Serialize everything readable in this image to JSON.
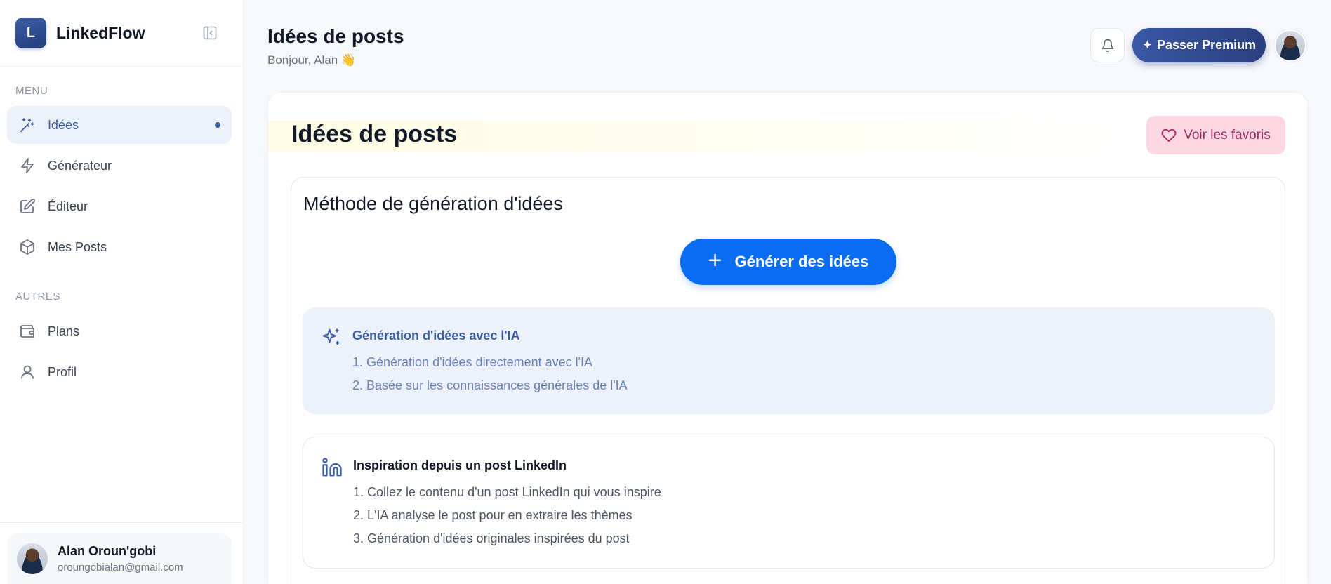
{
  "app": {
    "logo_letter": "L",
    "name": "LinkedFlow"
  },
  "sidebar": {
    "menu_label": "MENU",
    "items": [
      {
        "label": "Idées",
        "icon": "magic-wand-icon",
        "active": true
      },
      {
        "label": "Générateur",
        "icon": "lightning-icon"
      },
      {
        "label": "Éditeur",
        "icon": "edit-icon"
      },
      {
        "label": "Mes Posts",
        "icon": "box-icon"
      }
    ],
    "other_label": "AUTRES",
    "other_items": [
      {
        "label": "Plans",
        "icon": "wallet-icon"
      },
      {
        "label": "Profil",
        "icon": "user-icon"
      }
    ],
    "user": {
      "name": "Alan Oroun'gobi",
      "email": "oroungobialan@gmail.com"
    }
  },
  "header": {
    "title": "Idées de posts",
    "greeting": "Bonjour, Alan 👋",
    "premium_label": "Passer Premium",
    "premium_icon": "✦"
  },
  "main": {
    "title": "Idées de posts",
    "favorites_label": "Voir les favoris",
    "method": {
      "title": "Méthode de génération d'idées",
      "generate_label": "Générer des idées",
      "options": [
        {
          "title": "Génération d'idées avec l'IA",
          "icon": "sparkles-icon",
          "steps": [
            "1. Génération d'idées directement avec l'IA",
            "2. Basée sur les connaissances générales de l'IA"
          ]
        },
        {
          "title": "Inspiration depuis un post LinkedIn",
          "icon": "linkedin-icon",
          "steps": [
            "1. Collez le contenu d'un post LinkedIn qui vous inspire",
            "2. L'IA analyse le post pour en extraire les thèmes",
            "3. Génération d'idées originales inspirées du post"
          ]
        }
      ]
    }
  },
  "colors": {
    "brand": "#2f4a8f",
    "accent_blue": "#0a6cf0",
    "active_bg": "#edf1fa",
    "favorites_bg": "#fcd7e1"
  }
}
